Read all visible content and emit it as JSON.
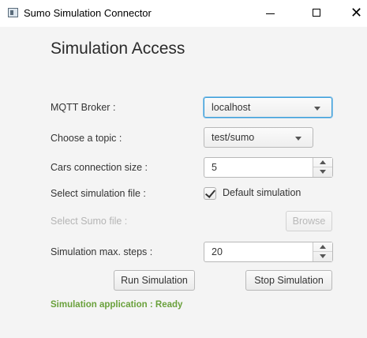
{
  "window": {
    "title": "Sumo Simulation Connector",
    "controls": {
      "minimize": "—",
      "maximize": "☐",
      "close": "✕"
    }
  },
  "form": {
    "heading": "Simulation Access",
    "broker": {
      "label": "MQTT Broker :",
      "value": "localhost"
    },
    "topic": {
      "label": "Choose a topic :",
      "value": "test/sumo"
    },
    "cars": {
      "label": "Cars connection size :",
      "value": "5"
    },
    "simulation_file": {
      "label": "Select simulation file :",
      "checkbox_label": "Default simulation",
      "checked": true
    },
    "sumo_file": {
      "label": "Select Sumo file :",
      "browse_label": "Browse"
    },
    "max_steps": {
      "label": "Simulation max. steps :",
      "value": "20"
    },
    "run_label": "Run Simulation",
    "stop_label": "Stop Simulation",
    "status": "Simulation application : Ready"
  },
  "colors": {
    "status": "#6aa13c",
    "focus": "#3a9ed8"
  }
}
